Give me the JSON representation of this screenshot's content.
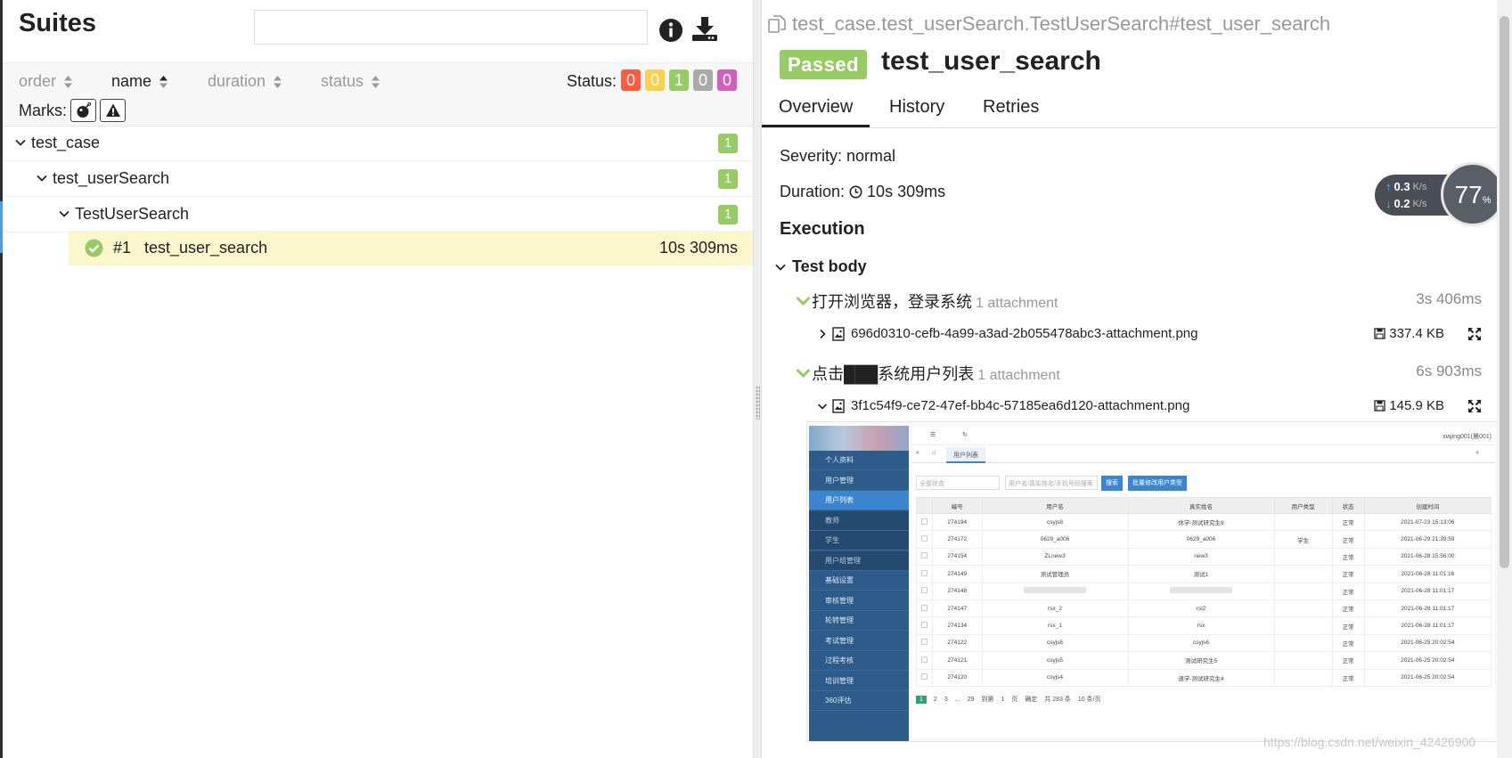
{
  "suites": {
    "title": "Suites",
    "search_placeholder": "",
    "info_icon": "info-icon",
    "download_icon": "download-icon"
  },
  "sort": [
    {
      "label": "order",
      "active": false
    },
    {
      "label": "name",
      "active": true
    },
    {
      "label": "duration",
      "active": false
    },
    {
      "label": "status",
      "active": false
    }
  ],
  "status": {
    "label": "Status:",
    "counts": [
      {
        "value": "0",
        "color": "#fd5a3e",
        "name": "failed"
      },
      {
        "value": "0",
        "color": "#ffd050",
        "name": "broken"
      },
      {
        "value": "1",
        "color": "#97cc64",
        "name": "passed"
      },
      {
        "value": "0",
        "color": "#aaaaaa",
        "name": "skipped"
      },
      {
        "value": "0",
        "color": "#d35ebe",
        "name": "unknown"
      }
    ]
  },
  "marks": {
    "label": "Marks:",
    "items": [
      "flaky-bomb-icon",
      "warning-icon"
    ]
  },
  "tree": [
    {
      "label": "test_case",
      "count": "1"
    },
    {
      "label": "test_userSearch",
      "count": "1"
    },
    {
      "label": "TestUserSearch",
      "count": "1"
    }
  ],
  "leaf": {
    "number": "#1",
    "name": "test_user_search",
    "duration": "10s 309ms"
  },
  "detail": {
    "fullname": "test_case.test_userSearch.TestUserSearch#test_user_search",
    "status_badge": "Passed",
    "title": "test_user_search",
    "tabs": [
      "Overview",
      "History",
      "Retries"
    ],
    "severity": "Severity: normal",
    "duration_label": "Duration:",
    "duration_value": "10s 309ms",
    "execution_title": "Execution",
    "test_body_label": "Test body",
    "steps": [
      {
        "name": "打开浏览器，登录系统",
        "attachment_count": "1 attachment",
        "duration": "3s 406ms",
        "attachment": {
          "name": "696d0310-cefb-4a99-a3ad-2b055478abc3-attachment.png",
          "size": "337.4 KB",
          "expanded": false
        }
      },
      {
        "name": "点击███系统用户列表",
        "attachment_count": "1 attachment",
        "duration": "6s 903ms",
        "attachment": {
          "name": "3f1c54f9-ce72-47ef-bb4c-57185ea6d120-attachment.png",
          "size": "145.9 KB",
          "expanded": true
        }
      }
    ]
  },
  "preview": {
    "nav": [
      {
        "label": "个人资料",
        "kind": "item"
      },
      {
        "label": "用户管理",
        "kind": "item"
      },
      {
        "label": "用户列表",
        "kind": "sel"
      },
      {
        "label": "教师",
        "kind": "sub"
      },
      {
        "label": "学生",
        "kind": "sub"
      },
      {
        "label": "用户组管理",
        "kind": "sub"
      },
      {
        "label": "基础设置",
        "kind": "item"
      },
      {
        "label": "审核管理",
        "kind": "item"
      },
      {
        "label": "轮转管理",
        "kind": "item"
      },
      {
        "label": "考试管理",
        "kind": "item"
      },
      {
        "label": "过程考核",
        "kind": "item"
      },
      {
        "label": "培训管理",
        "kind": "item"
      },
      {
        "label": "360评估",
        "kind": "item"
      }
    ],
    "user": "xiajing001(晨001)",
    "tab_label": "用户列表",
    "filter_placeholder": "全部状态",
    "search_placeholder": "用户名/真实姓名/手机号码搜索",
    "search_button": "搜索",
    "batch_button": "批量修改用户类型",
    "columns": [
      "编号",
      "用户名",
      "真实姓名",
      "用户类型",
      "状态",
      "创建时间"
    ],
    "rows": [
      [
        "274194",
        "csyjs8",
        "休学-测试研究生8",
        "",
        "正常",
        "2021-07-23 15:13:06"
      ],
      [
        "274172",
        "0629_a006",
        "0629_a006",
        "学生",
        "正常",
        "2021-06-29 21:39:59"
      ],
      [
        "274154",
        "ZLnew3",
        "new3",
        "",
        "正常",
        "2021-06-28 15:56:00"
      ],
      [
        "274149",
        "测试管理员",
        "测试1",
        "",
        "正常",
        "2021-06-28 11:01:16"
      ],
      [
        "274148",
        "",
        "",
        "",
        "正常",
        "2021-06-28 11:01:17"
      ],
      [
        "274147",
        "rsx_2",
        "rsl2",
        "",
        "正常",
        "2021-06-28 11:01:17"
      ],
      [
        "274134",
        "rsx_1",
        "rsx",
        "",
        "正常",
        "2021-06-28 11:01:17"
      ],
      [
        "274122",
        "csyjs6",
        "csyjs6",
        "",
        "正常",
        "2021-06-25 20:02:54"
      ],
      [
        "274121",
        "csyjs5",
        "测试研究生5",
        "",
        "正常",
        "2021-06-25 20:02:54"
      ],
      [
        "274120",
        "csyjs4",
        "退学-测试研究生4",
        "",
        "正常",
        "2021-06-25 20:02:54"
      ]
    ],
    "pager": [
      "1",
      "2",
      "3",
      "...",
      "29",
      "到第",
      "1",
      "页",
      "确定",
      "共 283 条",
      "10 条/页"
    ]
  },
  "network": {
    "up": "0.3",
    "down": "0.2",
    "unit": "K/s",
    "percent": "77",
    "percent_unit": "%"
  },
  "watermark": "https://blog.csdn.net/weixin_42426900"
}
